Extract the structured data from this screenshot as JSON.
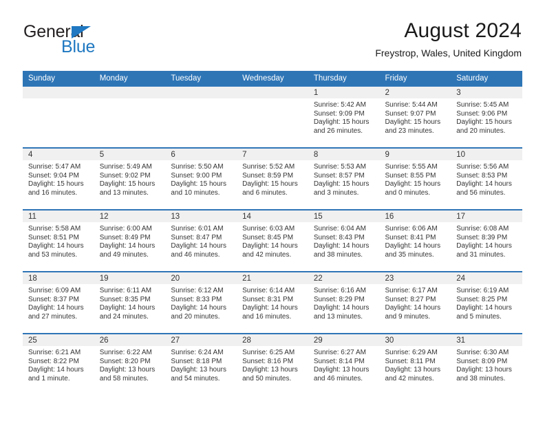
{
  "brand": {
    "name_part1": "General",
    "name_part2": "Blue",
    "triangle_color": "#1f78c1"
  },
  "header": {
    "title": "August 2024",
    "subtitle": "Freystrop, Wales, United Kingdom"
  },
  "theme": {
    "header_blue": "#2e75b6",
    "daynum_band": "#f0f0f0",
    "text": "#333333"
  },
  "calendar": {
    "weekday_headers": [
      "Sunday",
      "Monday",
      "Tuesday",
      "Wednesday",
      "Thursday",
      "Friday",
      "Saturday"
    ],
    "weeks": [
      [
        {
          "day": "",
          "sunrise": "",
          "sunset": "",
          "daylight_line1": "",
          "daylight_line2": "",
          "empty": true
        },
        {
          "day": "",
          "sunrise": "",
          "sunset": "",
          "daylight_line1": "",
          "daylight_line2": "",
          "empty": true
        },
        {
          "day": "",
          "sunrise": "",
          "sunset": "",
          "daylight_line1": "",
          "daylight_line2": "",
          "empty": true
        },
        {
          "day": "",
          "sunrise": "",
          "sunset": "",
          "daylight_line1": "",
          "daylight_line2": "",
          "empty": true
        },
        {
          "day": "1",
          "sunrise": "Sunrise: 5:42 AM",
          "sunset": "Sunset: 9:09 PM",
          "daylight_line1": "Daylight: 15 hours",
          "daylight_line2": "and 26 minutes."
        },
        {
          "day": "2",
          "sunrise": "Sunrise: 5:44 AM",
          "sunset": "Sunset: 9:07 PM",
          "daylight_line1": "Daylight: 15 hours",
          "daylight_line2": "and 23 minutes."
        },
        {
          "day": "3",
          "sunrise": "Sunrise: 5:45 AM",
          "sunset": "Sunset: 9:06 PM",
          "daylight_line1": "Daylight: 15 hours",
          "daylight_line2": "and 20 minutes."
        }
      ],
      [
        {
          "day": "4",
          "sunrise": "Sunrise: 5:47 AM",
          "sunset": "Sunset: 9:04 PM",
          "daylight_line1": "Daylight: 15 hours",
          "daylight_line2": "and 16 minutes."
        },
        {
          "day": "5",
          "sunrise": "Sunrise: 5:49 AM",
          "sunset": "Sunset: 9:02 PM",
          "daylight_line1": "Daylight: 15 hours",
          "daylight_line2": "and 13 minutes."
        },
        {
          "day": "6",
          "sunrise": "Sunrise: 5:50 AM",
          "sunset": "Sunset: 9:00 PM",
          "daylight_line1": "Daylight: 15 hours",
          "daylight_line2": "and 10 minutes."
        },
        {
          "day": "7",
          "sunrise": "Sunrise: 5:52 AM",
          "sunset": "Sunset: 8:59 PM",
          "daylight_line1": "Daylight: 15 hours",
          "daylight_line2": "and 6 minutes."
        },
        {
          "day": "8",
          "sunrise": "Sunrise: 5:53 AM",
          "sunset": "Sunset: 8:57 PM",
          "daylight_line1": "Daylight: 15 hours",
          "daylight_line2": "and 3 minutes."
        },
        {
          "day": "9",
          "sunrise": "Sunrise: 5:55 AM",
          "sunset": "Sunset: 8:55 PM",
          "daylight_line1": "Daylight: 15 hours",
          "daylight_line2": "and 0 minutes."
        },
        {
          "day": "10",
          "sunrise": "Sunrise: 5:56 AM",
          "sunset": "Sunset: 8:53 PM",
          "daylight_line1": "Daylight: 14 hours",
          "daylight_line2": "and 56 minutes."
        }
      ],
      [
        {
          "day": "11",
          "sunrise": "Sunrise: 5:58 AM",
          "sunset": "Sunset: 8:51 PM",
          "daylight_line1": "Daylight: 14 hours",
          "daylight_line2": "and 53 minutes."
        },
        {
          "day": "12",
          "sunrise": "Sunrise: 6:00 AM",
          "sunset": "Sunset: 8:49 PM",
          "daylight_line1": "Daylight: 14 hours",
          "daylight_line2": "and 49 minutes."
        },
        {
          "day": "13",
          "sunrise": "Sunrise: 6:01 AM",
          "sunset": "Sunset: 8:47 PM",
          "daylight_line1": "Daylight: 14 hours",
          "daylight_line2": "and 46 minutes."
        },
        {
          "day": "14",
          "sunrise": "Sunrise: 6:03 AM",
          "sunset": "Sunset: 8:45 PM",
          "daylight_line1": "Daylight: 14 hours",
          "daylight_line2": "and 42 minutes."
        },
        {
          "day": "15",
          "sunrise": "Sunrise: 6:04 AM",
          "sunset": "Sunset: 8:43 PM",
          "daylight_line1": "Daylight: 14 hours",
          "daylight_line2": "and 38 minutes."
        },
        {
          "day": "16",
          "sunrise": "Sunrise: 6:06 AM",
          "sunset": "Sunset: 8:41 PM",
          "daylight_line1": "Daylight: 14 hours",
          "daylight_line2": "and 35 minutes."
        },
        {
          "day": "17",
          "sunrise": "Sunrise: 6:08 AM",
          "sunset": "Sunset: 8:39 PM",
          "daylight_line1": "Daylight: 14 hours",
          "daylight_line2": "and 31 minutes."
        }
      ],
      [
        {
          "day": "18",
          "sunrise": "Sunrise: 6:09 AM",
          "sunset": "Sunset: 8:37 PM",
          "daylight_line1": "Daylight: 14 hours",
          "daylight_line2": "and 27 minutes."
        },
        {
          "day": "19",
          "sunrise": "Sunrise: 6:11 AM",
          "sunset": "Sunset: 8:35 PM",
          "daylight_line1": "Daylight: 14 hours",
          "daylight_line2": "and 24 minutes."
        },
        {
          "day": "20",
          "sunrise": "Sunrise: 6:12 AM",
          "sunset": "Sunset: 8:33 PM",
          "daylight_line1": "Daylight: 14 hours",
          "daylight_line2": "and 20 minutes."
        },
        {
          "day": "21",
          "sunrise": "Sunrise: 6:14 AM",
          "sunset": "Sunset: 8:31 PM",
          "daylight_line1": "Daylight: 14 hours",
          "daylight_line2": "and 16 minutes."
        },
        {
          "day": "22",
          "sunrise": "Sunrise: 6:16 AM",
          "sunset": "Sunset: 8:29 PM",
          "daylight_line1": "Daylight: 14 hours",
          "daylight_line2": "and 13 minutes."
        },
        {
          "day": "23",
          "sunrise": "Sunrise: 6:17 AM",
          "sunset": "Sunset: 8:27 PM",
          "daylight_line1": "Daylight: 14 hours",
          "daylight_line2": "and 9 minutes."
        },
        {
          "day": "24",
          "sunrise": "Sunrise: 6:19 AM",
          "sunset": "Sunset: 8:25 PM",
          "daylight_line1": "Daylight: 14 hours",
          "daylight_line2": "and 5 minutes."
        }
      ],
      [
        {
          "day": "25",
          "sunrise": "Sunrise: 6:21 AM",
          "sunset": "Sunset: 8:22 PM",
          "daylight_line1": "Daylight: 14 hours",
          "daylight_line2": "and 1 minute."
        },
        {
          "day": "26",
          "sunrise": "Sunrise: 6:22 AM",
          "sunset": "Sunset: 8:20 PM",
          "daylight_line1": "Daylight: 13 hours",
          "daylight_line2": "and 58 minutes."
        },
        {
          "day": "27",
          "sunrise": "Sunrise: 6:24 AM",
          "sunset": "Sunset: 8:18 PM",
          "daylight_line1": "Daylight: 13 hours",
          "daylight_line2": "and 54 minutes."
        },
        {
          "day": "28",
          "sunrise": "Sunrise: 6:25 AM",
          "sunset": "Sunset: 8:16 PM",
          "daylight_line1": "Daylight: 13 hours",
          "daylight_line2": "and 50 minutes."
        },
        {
          "day": "29",
          "sunrise": "Sunrise: 6:27 AM",
          "sunset": "Sunset: 8:14 PM",
          "daylight_line1": "Daylight: 13 hours",
          "daylight_line2": "and 46 minutes."
        },
        {
          "day": "30",
          "sunrise": "Sunrise: 6:29 AM",
          "sunset": "Sunset: 8:11 PM",
          "daylight_line1": "Daylight: 13 hours",
          "daylight_line2": "and 42 minutes."
        },
        {
          "day": "31",
          "sunrise": "Sunrise: 6:30 AM",
          "sunset": "Sunset: 8:09 PM",
          "daylight_line1": "Daylight: 13 hours",
          "daylight_line2": "and 38 minutes."
        }
      ]
    ]
  }
}
